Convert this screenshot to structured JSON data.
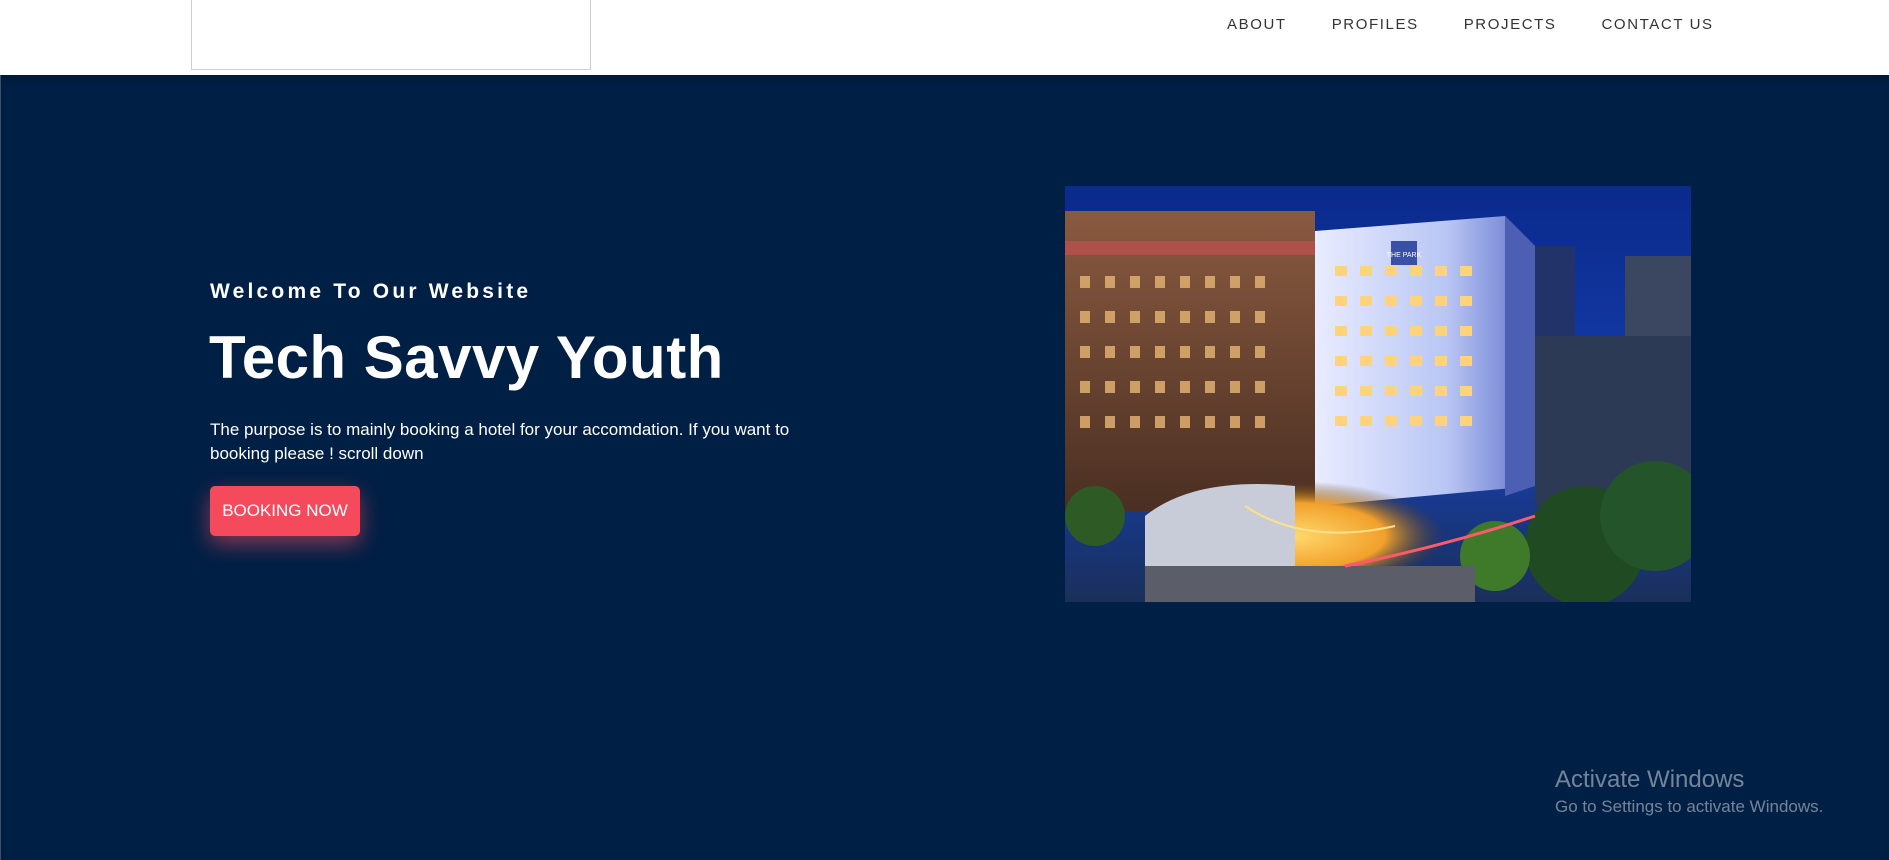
{
  "header": {
    "nav": [
      {
        "label": "ABOUT"
      },
      {
        "label": "PROFILES"
      },
      {
        "label": "PROJECTS"
      },
      {
        "label": "CONTACT US"
      }
    ]
  },
  "hero": {
    "welcome": "Welcome To Our Website",
    "title": "Tech Savvy Youth",
    "description": "The purpose is to mainly booking a hotel for your accomdation. If you want to booking please ! scroll down",
    "button_label": "BOOKING NOW",
    "image_sign": "THE PARK"
  },
  "watermark": {
    "title": "Activate Windows",
    "subtitle": "Go to Settings to activate Windows."
  },
  "colors": {
    "hero_background": "#001f45",
    "button": "#f44a5c",
    "nav_text": "#333333"
  }
}
